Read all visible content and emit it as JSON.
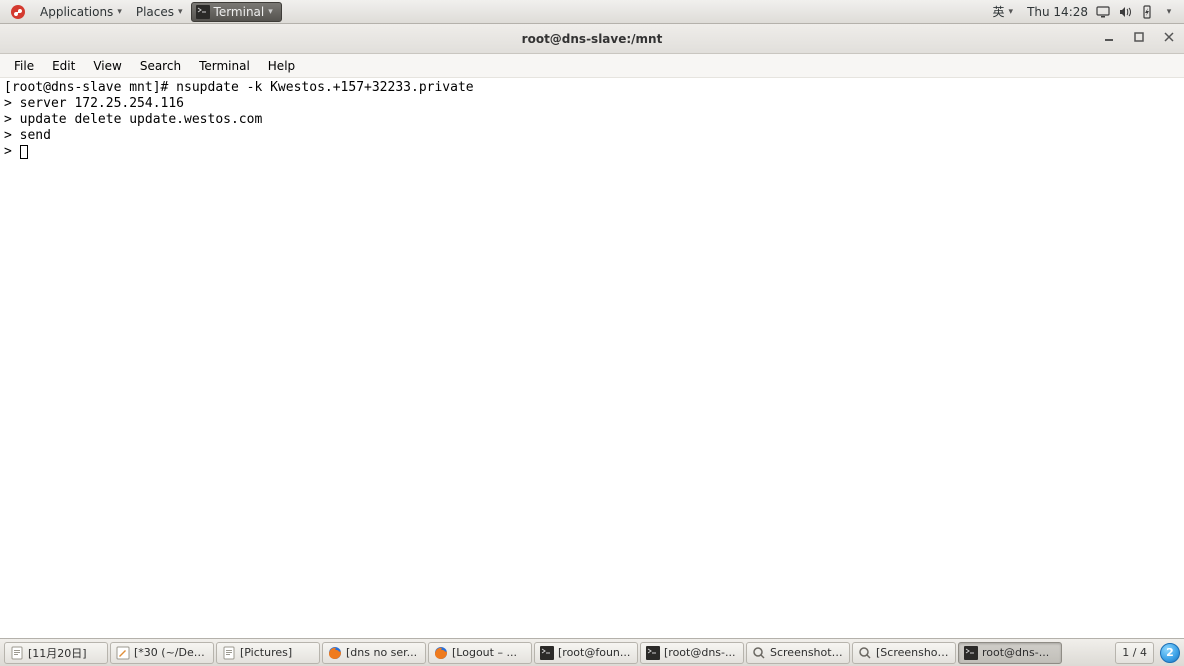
{
  "top_panel": {
    "applications": "Applications",
    "places": "Places",
    "open_app": "Terminal",
    "ime": "英",
    "clock": "Thu 14:28"
  },
  "window": {
    "title": "root@dns-slave:/mnt",
    "menu": {
      "file": "File",
      "edit": "Edit",
      "view": "View",
      "search": "Search",
      "terminal": "Terminal",
      "help": "Help"
    }
  },
  "terminal": {
    "lines": [
      "[root@dns-slave mnt]# nsupdate -k Kwestos.+157+32233.private",
      "> server 172.25.254.116",
      "> update delete update.westos.com",
      "> send",
      "> "
    ]
  },
  "taskbar": {
    "items": [
      {
        "label": "[11月20日]",
        "icon": "doc"
      },
      {
        "label": "[*30 (~/Des...",
        "icon": "edit"
      },
      {
        "label": "[Pictures]",
        "icon": "doc"
      },
      {
        "label": "[dns no ser...",
        "icon": "firefox"
      },
      {
        "label": "[Logout – ...",
        "icon": "firefox"
      },
      {
        "label": "[root@foun...",
        "icon": "term"
      },
      {
        "label": "[root@dns-...",
        "icon": "term"
      },
      {
        "label": "Screenshot ...",
        "icon": "mag"
      },
      {
        "label": "[Screenshot...",
        "icon": "mag"
      },
      {
        "label": "root@dns-...",
        "icon": "term",
        "active": true
      }
    ],
    "workspace": "1 / 4",
    "badge": "2"
  }
}
